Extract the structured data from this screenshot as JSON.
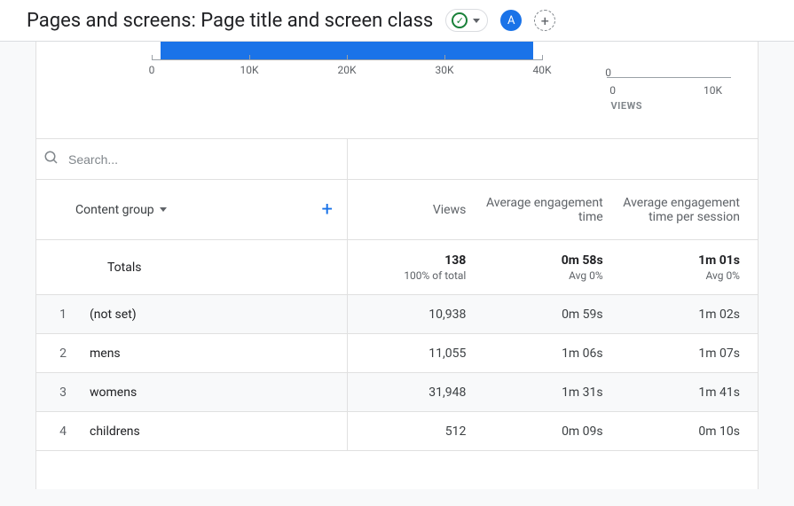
{
  "header": {
    "title": "Pages and screens: Page title and screen class",
    "avatar_letter": "A"
  },
  "chart_data": {
    "type": "bar",
    "x_ticks": [
      "0",
      "10K",
      "20K",
      "30K",
      "40K"
    ],
    "series": [
      {
        "name": "Views",
        "value_approx": 40000
      }
    ],
    "secondary_axis": {
      "y_tick": "0",
      "x_ticks": [
        "0",
        "10K"
      ],
      "label": "VIEWS"
    }
  },
  "search": {
    "placeholder": "Search..."
  },
  "table": {
    "dimension_label": "Content group",
    "metrics": [
      {
        "label": "Views"
      },
      {
        "label": "Average engagement time"
      },
      {
        "label": "Average engagement time per session"
      }
    ],
    "totals": {
      "label": "Totals",
      "values": [
        {
          "big": "138",
          "sub": "100% of total"
        },
        {
          "big": "0m 58s",
          "sub": "Avg 0%"
        },
        {
          "big": "1m 01s",
          "sub": "Avg 0%"
        }
      ]
    },
    "rows": [
      {
        "idx": "1",
        "label": "(not set)",
        "cells": [
          "10,938",
          "0m 59s",
          "1m 02s"
        ]
      },
      {
        "idx": "2",
        "label": "mens",
        "cells": [
          "11,055",
          "1m 06s",
          "1m 07s"
        ]
      },
      {
        "idx": "3",
        "label": "womens",
        "cells": [
          "31,948",
          "1m 31s",
          "1m 41s"
        ]
      },
      {
        "idx": "4",
        "label": "childrens",
        "cells": [
          "512",
          "0m 09s",
          "0m 10s"
        ]
      }
    ]
  }
}
